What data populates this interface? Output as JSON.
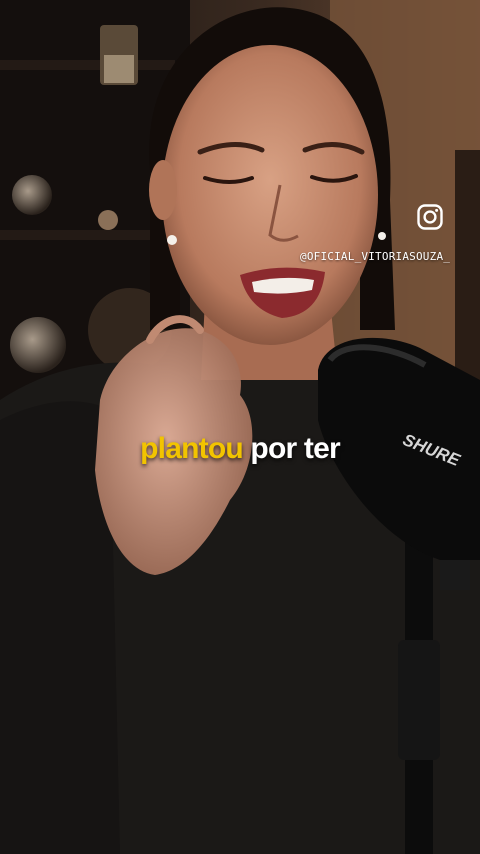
{
  "overlay": {
    "social_icon": "instagram-icon",
    "handle": "@OFICIAL_VITORIASOUZA_"
  },
  "caption": {
    "highlight": "plantou",
    "rest": "por ter",
    "highlight_color": "#f2c400",
    "text_color": "#ffffff"
  },
  "scene": {
    "microphone_brand": "SHURE"
  }
}
